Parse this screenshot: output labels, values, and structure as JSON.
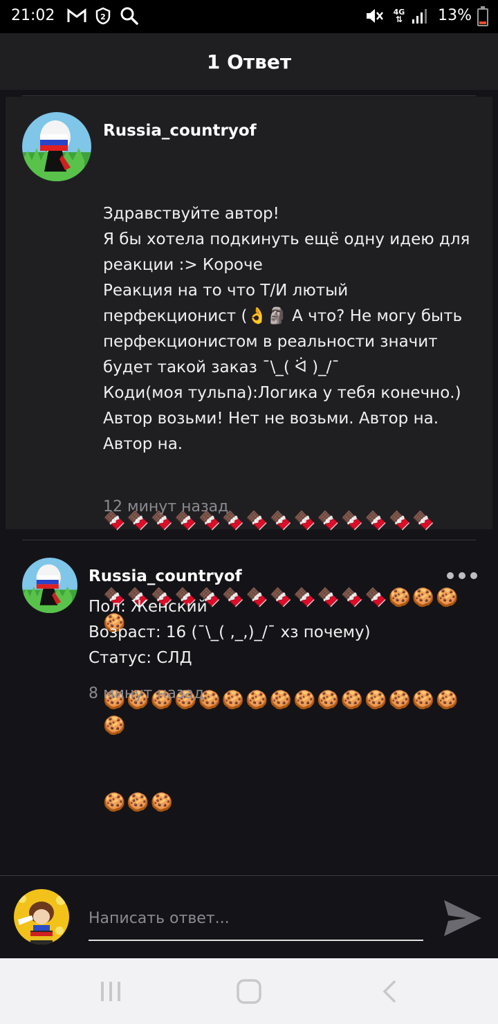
{
  "status_bar": {
    "time": "21:02",
    "battery": "13%",
    "network": "4G",
    "icons": [
      "gmail-icon",
      "shield-icon",
      "search-icon",
      "mute-icon",
      "signal-icon",
      "battery-icon"
    ]
  },
  "header": {
    "title": "1 Ответ"
  },
  "comments": [
    {
      "username": "Russia_countryof",
      "text": "Здравствуйте автор!\nЯ бы хотела подкинуть ещё одну идею для реакции :> Короче\nРеакция на то что Т/И лютый перфекционист (👌🗿 А что? Не могу быть перфекционистом в реальности значит будет такой заказ ¯\\_( ᐛ )_/¯\nКоди(моя тульпа):Логика у тебя конечно.)\nАвтор возьми! Нет не возьми. Автор на. Автор на.",
      "emoji_line_1": "🍫🍫🍫🍫🍫🍫🍫🍫🍫🍫🍫🍫🍫🍫",
      "emoji_line_2": "🍫🍫🍫🍫🍫🍫🍫🍫🍫🍫🍫🍫🍪🍪🍪🍪",
      "emoji_line_3": "🍪🍪🍪🍪🍪🍪🍪🍪🍪🍪🍪🍪🍪🍪🍪🍪",
      "emoji_line_4": "🍪🍪🍪",
      "time": "12 минут назад"
    },
    {
      "username": "Russia_countryof",
      "text": "Пол: Женский\nВозраст: 16 (¯\\_( ,_,)_/¯ хз почему)\nСтатус: СЛД",
      "time": "8 минут назад"
    }
  ],
  "reply": {
    "placeholder": "Написать ответ..."
  },
  "colors": {
    "background": "#141418",
    "highlight": "#1f1f22",
    "muted": "#8a8a90",
    "battery_low": "#e74c2c"
  }
}
